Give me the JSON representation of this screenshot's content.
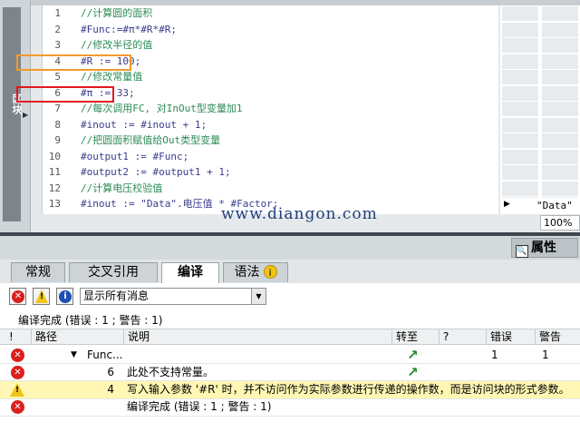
{
  "left_panel": {
    "label": "区块"
  },
  "editor": {
    "lines": [
      {
        "num": "1",
        "text": "//计算圆的面积",
        "kind": "comment"
      },
      {
        "num": "2",
        "text": "#Func:=#π*#R*#R;",
        "kind": "stmt"
      },
      {
        "num": "3",
        "text": "//修改半径的值",
        "kind": "comment"
      },
      {
        "num": "4",
        "text": "#R := 100;",
        "kind": "stmt"
      },
      {
        "num": "5",
        "text": "//修改常量值",
        "kind": "comment"
      },
      {
        "num": "6",
        "text": "#π := 33;",
        "kind": "stmt"
      },
      {
        "num": "7",
        "text": "//每次调用FC, 对InOut型变量加1",
        "kind": "comment"
      },
      {
        "num": "8",
        "text": "#inout := #inout + 1;",
        "kind": "stmt"
      },
      {
        "num": "9",
        "text": "//把圆面积赋值给Out类型变量",
        "kind": "comment"
      },
      {
        "num": "10",
        "text": "#output1 := #Func;",
        "kind": "stmt"
      },
      {
        "num": "11",
        "text": "#output2 := #output1 + 1;",
        "kind": "stmt"
      },
      {
        "num": "12",
        "text": "//计算电压校验值",
        "kind": "comment"
      },
      {
        "num": "13",
        "text": "#inout := \"Data\".电压值 * #Factor;",
        "kind": "stmt"
      }
    ],
    "right_value": "\"Data\"",
    "zoom": "100%",
    "watermark": "www.diangon.com",
    "highlight_colors": {
      "orange": "#f39a2c",
      "red": "#e3171f"
    }
  },
  "inspector": {
    "properties_label": "属性",
    "tabs": [
      "常规",
      "交叉引用",
      "编译",
      "语法"
    ],
    "active_tab": "编译",
    "filter": {
      "selected": "显示所有消息"
    },
    "summary": "编译完成 (错误 : 1 ; 警告 : 1)",
    "columns": [
      "!",
      "路径",
      "说明",
      "转至",
      "?",
      "错误",
      "警告"
    ],
    "rows": [
      {
        "icon": "error-icon",
        "path": "Func...",
        "desc": "",
        "goto": true,
        "errors": "1",
        "warnings": "1"
      },
      {
        "icon": "error-icon",
        "path": "6",
        "desc": "此处不支持常量。",
        "goto": true,
        "errors": "",
        "warnings": ""
      },
      {
        "icon": "warning-icon",
        "path": "4",
        "desc": "写入输入参数 '#R' 时，并不访问作为实际参数进行传递的操作数，而是访问块的形式参数。",
        "goto": false,
        "errors": "",
        "warnings": ""
      },
      {
        "icon": "error-icon",
        "path": "",
        "desc": "编译完成 (错误 : 1 ; 警告 : 1)",
        "goto": false,
        "errors": "",
        "warnings": ""
      }
    ]
  }
}
